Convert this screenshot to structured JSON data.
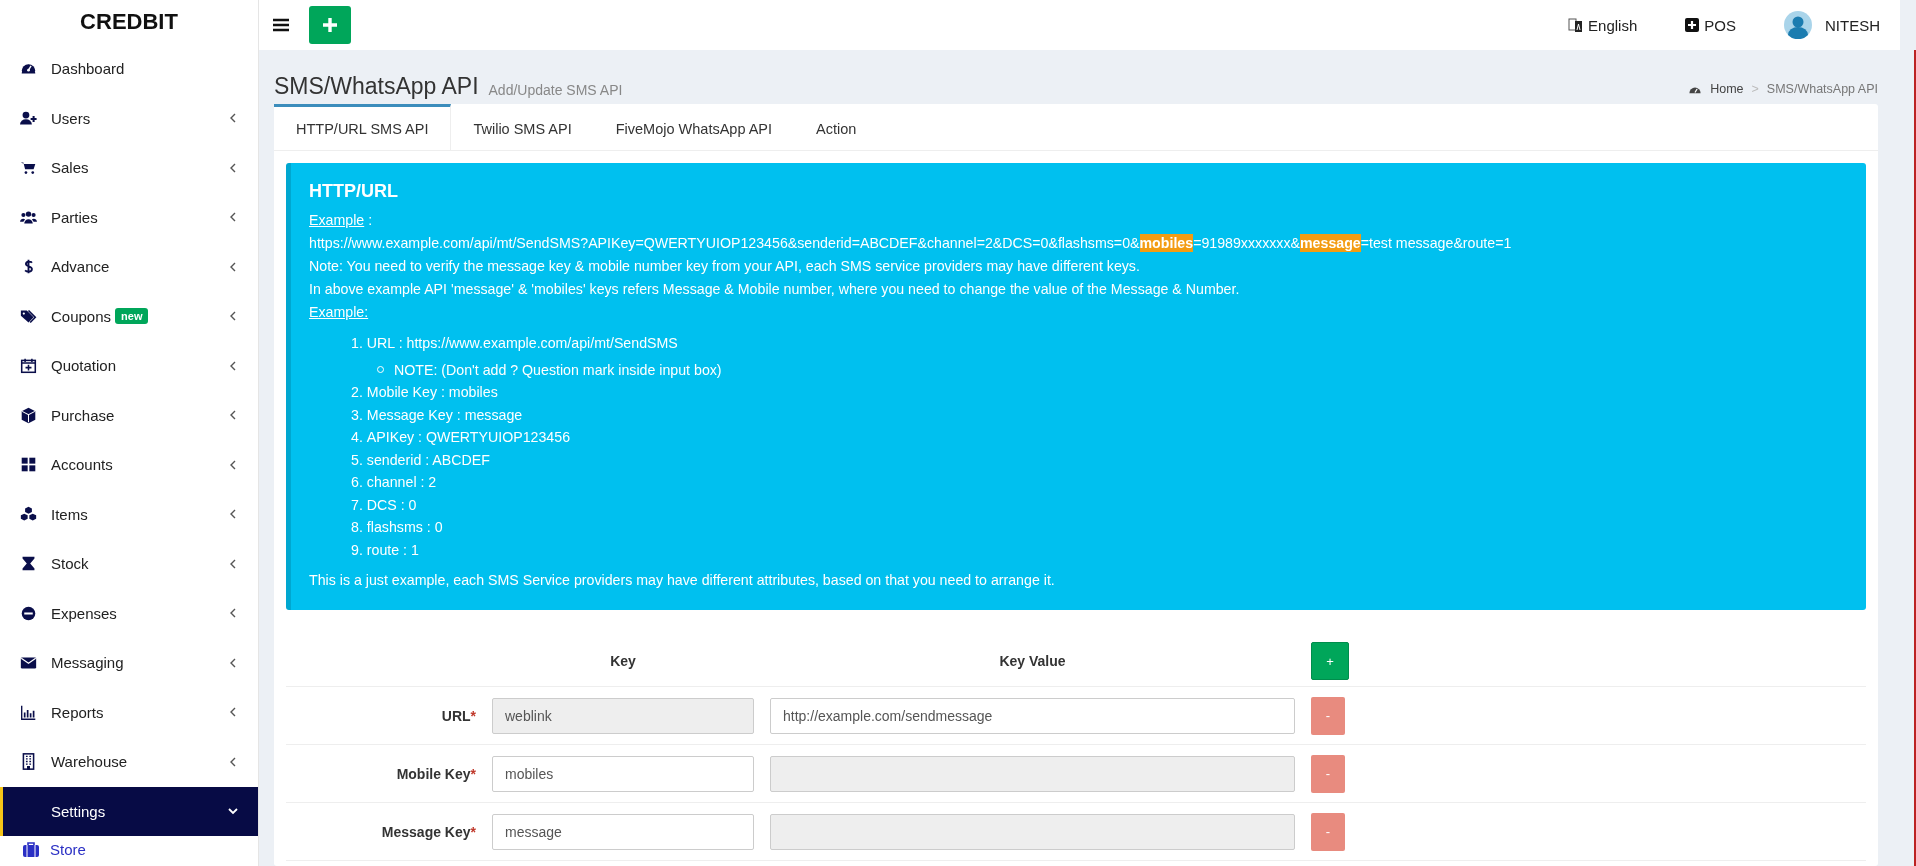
{
  "brand": "CREDBIT",
  "topbar": {
    "language": "English",
    "pos": "POS",
    "user": "NITESH"
  },
  "sidebar": {
    "items": [
      {
        "label": "Dashboard",
        "has_submenu": false,
        "expanded": false,
        "selected": false
      },
      {
        "label": "Users",
        "has_submenu": true,
        "expanded": false,
        "selected": false
      },
      {
        "label": "Sales",
        "has_submenu": true,
        "expanded": false,
        "selected": false
      },
      {
        "label": "Parties",
        "has_submenu": true,
        "expanded": false,
        "selected": false
      },
      {
        "label": "Advance",
        "has_submenu": true,
        "expanded": false,
        "selected": false
      },
      {
        "label": "Coupons",
        "badge": "new",
        "has_submenu": true,
        "expanded": false,
        "selected": false
      },
      {
        "label": "Quotation",
        "has_submenu": true,
        "expanded": false,
        "selected": false
      },
      {
        "label": "Purchase",
        "has_submenu": true,
        "expanded": false,
        "selected": false
      },
      {
        "label": "Accounts",
        "has_submenu": true,
        "expanded": false,
        "selected": false
      },
      {
        "label": "Items",
        "has_submenu": true,
        "expanded": false,
        "selected": false
      },
      {
        "label": "Stock",
        "has_submenu": true,
        "expanded": false,
        "selected": false
      },
      {
        "label": "Expenses",
        "has_submenu": true,
        "expanded": false,
        "selected": false
      },
      {
        "label": "Messaging",
        "has_submenu": true,
        "expanded": false,
        "selected": false
      },
      {
        "label": "Reports",
        "has_submenu": true,
        "expanded": false,
        "selected": false
      },
      {
        "label": "Warehouse",
        "has_submenu": true,
        "expanded": false,
        "selected": false
      },
      {
        "label": "Settings",
        "has_submenu": true,
        "expanded": true,
        "selected": true,
        "children": [
          {
            "label": "Store"
          }
        ]
      }
    ]
  },
  "header": {
    "title": "SMS/WhatsApp API",
    "subtitle": "Add/Update SMS API",
    "breadcrumb": [
      "Home",
      "SMS/WhatsApp API"
    ],
    "breadcrumb_separator": ">"
  },
  "tabs": [
    {
      "label": "HTTP/URL SMS API",
      "selected": true
    },
    {
      "label": "Twilio SMS API",
      "selected": false
    },
    {
      "label": "FiveMojo WhatsApp API",
      "selected": false
    },
    {
      "label": "Action",
      "selected": false
    }
  ],
  "info": {
    "title": "HTTP/URL",
    "example_label": "Example",
    "example_suffix": ":",
    "url_segments": [
      {
        "text": "https://www.example.com/api/mt/SendSMS?APIKey=QWERTYUIOP123456&senderid=ABCDEF&channel=2&DCS=0&flashsms=0&",
        "highlighted": false
      },
      {
        "text": "mobiles",
        "highlighted": true
      },
      {
        "text": "=91989xxxxxxx&",
        "highlighted": false
      },
      {
        "text": "message",
        "highlighted": true
      },
      {
        "text": "=test message&route=1",
        "highlighted": false
      }
    ],
    "notes": [
      "Note: You need to verify the message key & mobile number key from your API, each SMS service providers may have different keys.",
      "In above example API 'message' & 'mobiles' keys refers Message & Mobile number, where you need to change the value of the Message & Number."
    ],
    "example2_label": "Example:",
    "steps": [
      {
        "number": "1.",
        "text": "URL : https://www.example.com/api/mt/SendSMS",
        "children": [
          {
            "text": "NOTE: (Don't add ? Question mark inside input box)"
          }
        ]
      },
      {
        "number": "2.",
        "text": "Mobile Key : mobiles"
      },
      {
        "number": "3.",
        "text": "Message Key : message"
      },
      {
        "number": "4.",
        "text": "APIKey : QWERTYUIOP123456"
      },
      {
        "number": "5.",
        "text": "senderid : ABCDEF"
      },
      {
        "number": "6.",
        "text": "channel : 2"
      },
      {
        "number": "7.",
        "text": "DCS : 0"
      },
      {
        "number": "8.",
        "text": "flashsms : 0"
      },
      {
        "number": "9.",
        "text": "route : 1"
      }
    ],
    "footer": "This is a just example, each SMS Service providers may have different attributes, based on that you need to arrange it."
  },
  "table": {
    "columns": [
      "Key",
      "Key Value"
    ],
    "add_button": "+",
    "rows": [
      {
        "label": "URL",
        "required_mark": "*",
        "key": "weblink",
        "key_disabled": true,
        "value": "http://example.com/sendmessage",
        "value_disabled": false,
        "remove_button": "-"
      },
      {
        "label": "Mobile Key",
        "required_mark": "*",
        "key": "mobiles",
        "key_disabled": false,
        "value": "",
        "value_disabled": true,
        "remove_button": "-"
      },
      {
        "label": "Message Key",
        "required_mark": "*",
        "key": "message",
        "key_disabled": false,
        "value": "",
        "value_disabled": true,
        "remove_button": "-"
      }
    ]
  }
}
